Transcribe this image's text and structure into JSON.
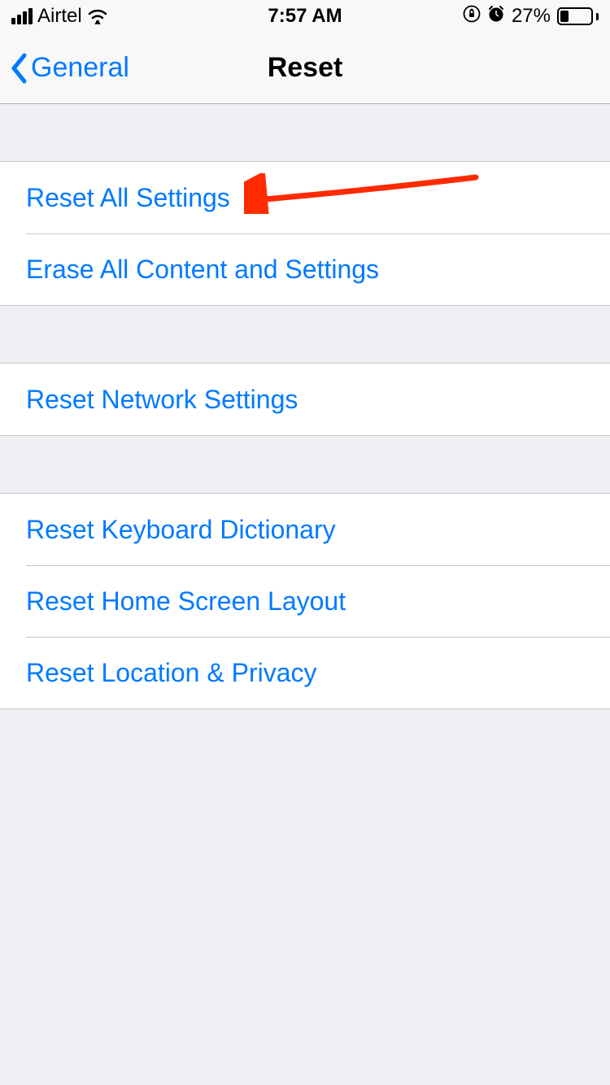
{
  "status_bar": {
    "carrier": "Airtel",
    "time": "7:57 AM",
    "battery_percent": "27%"
  },
  "nav": {
    "back_label": "General",
    "title": "Reset"
  },
  "groups": [
    {
      "items": [
        {
          "label": "Reset All Settings"
        },
        {
          "label": "Erase All Content and Settings"
        }
      ]
    },
    {
      "items": [
        {
          "label": "Reset Network Settings"
        }
      ]
    },
    {
      "items": [
        {
          "label": "Reset Keyboard Dictionary"
        },
        {
          "label": "Reset Home Screen Layout"
        },
        {
          "label": "Reset Location & Privacy"
        }
      ]
    }
  ],
  "annotation": {
    "arrow_color": "#ff2a00"
  }
}
